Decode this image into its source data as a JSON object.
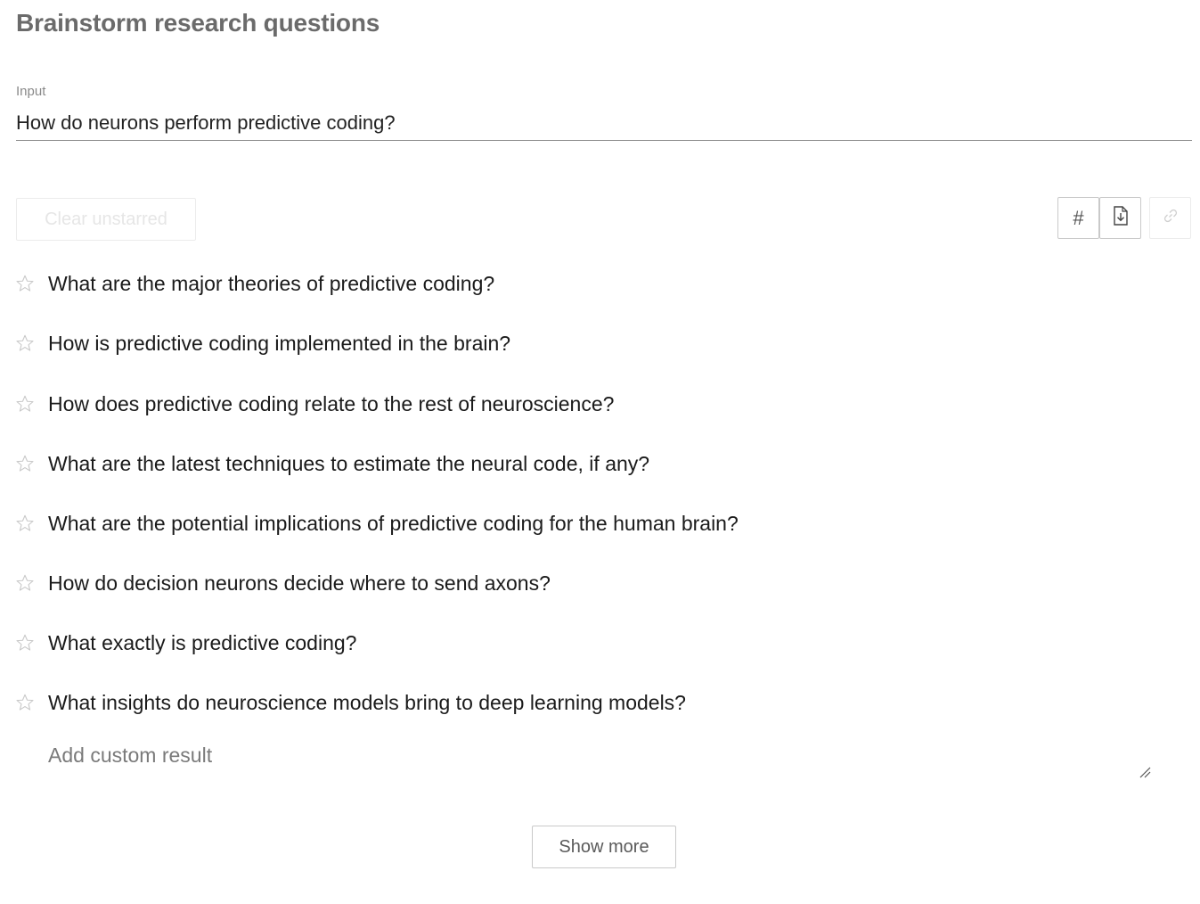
{
  "header": {
    "title": "Brainstorm research questions"
  },
  "input": {
    "label": "Input",
    "value": "How do neurons perform predictive coding?"
  },
  "toolbar": {
    "clear_label": "Clear unstarred",
    "hash_label": "#",
    "download_icon": "download-file-icon",
    "link_icon": "link-icon"
  },
  "results": [
    {
      "text": "What are the major theories of predictive coding?",
      "starred": false
    },
    {
      "text": "How is predictive coding implemented in the brain?",
      "starred": false
    },
    {
      "text": "How does predictive coding relate to the rest of neuroscience?",
      "starred": false
    },
    {
      "text": "What are the latest techniques to estimate the neural code, if any?",
      "starred": false
    },
    {
      "text": "What are the potential implications of predictive coding for the human brain?",
      "starred": false
    },
    {
      "text": "How do decision neurons decide where to send axons?",
      "starred": false
    },
    {
      "text": "What exactly is predictive coding?",
      "starred": false
    },
    {
      "text": "What insights do neuroscience models bring to deep learning models?",
      "starred": false
    }
  ],
  "custom": {
    "placeholder": "Add custom result"
  },
  "footer": {
    "show_more_label": "Show more"
  },
  "colors": {
    "title": "#6b6b6b",
    "star_outline": "#c8c8c8",
    "disabled_text": "#e6e6e6",
    "border": "#c9c9c9"
  }
}
